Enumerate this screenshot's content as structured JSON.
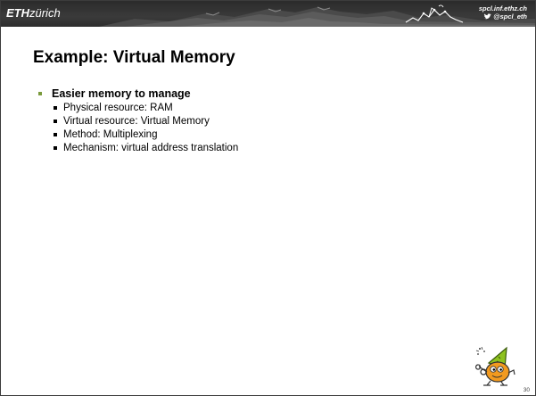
{
  "header": {
    "logo_bold": "ETH",
    "logo_light": "zürich",
    "url": "spcl.inf.ethz.ch",
    "twitter": "@spcl_eth"
  },
  "slide": {
    "title": "Example: Virtual Memory",
    "bullets": [
      {
        "text": "Easier memory to manage",
        "sub": [
          "Physical resource: RAM",
          "Virtual resource: Virtual Memory",
          "Method: Multiplexing",
          "Mechanism: virtual address translation"
        ]
      }
    ],
    "page_number": "30"
  },
  "colors": {
    "header_bg": "#2e2e2e",
    "bullet_accent": "#7a9a3c",
    "mascot_hat": "#8ec21f",
    "mascot_body": "#f29a1f"
  },
  "icons": [
    "mountains-banner",
    "spcl-brand-graphic",
    "twitter-bird-icon",
    "mascot-wizard"
  ]
}
